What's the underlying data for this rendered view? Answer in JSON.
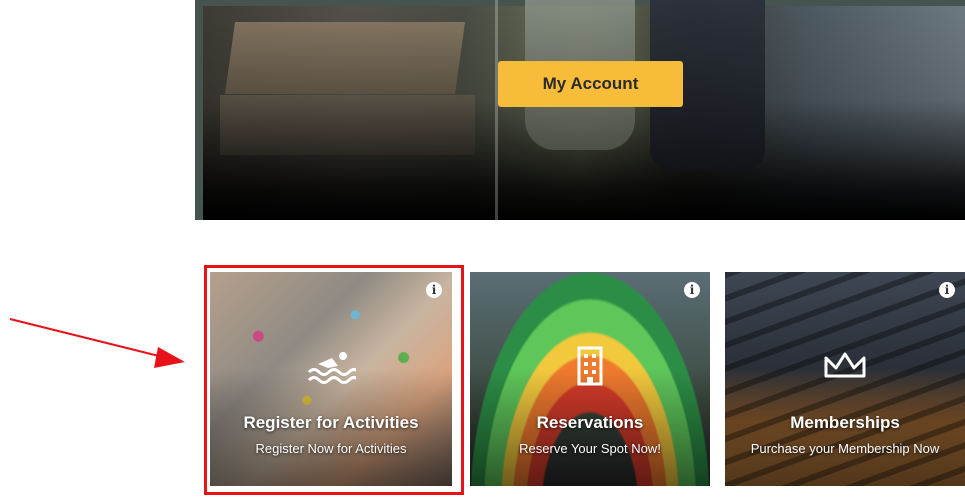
{
  "hero": {
    "account_button_label": "My Account"
  },
  "tiles": [
    {
      "title": "Register for Activities",
      "subtitle": "Register Now for Activities",
      "icon": "swimming-icon",
      "highlighted": true
    },
    {
      "title": "Reservations",
      "subtitle": "Reserve Your Spot Now!",
      "icon": "building-icon",
      "highlighted": false
    },
    {
      "title": "Memberships",
      "subtitle": "Purchase your Membership Now",
      "icon": "crown-icon",
      "highlighted": false
    }
  ],
  "info_glyph": "i",
  "annotation": {
    "highlight_color": "#e8121b",
    "arrow_color": "#e8121b"
  },
  "colors": {
    "button_bg": "#f6bc3a",
    "frame_border": "#46544f"
  }
}
